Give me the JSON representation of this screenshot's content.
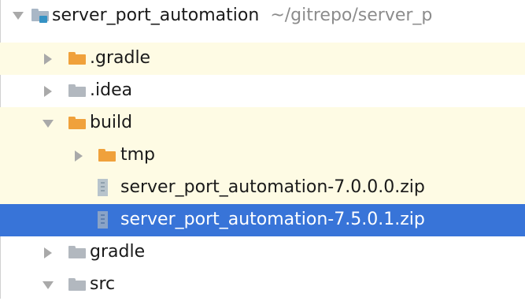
{
  "tree": {
    "root": {
      "name": "server_port_automation",
      "path": "~/gitrepo/server_p"
    },
    "items": [
      {
        "label": ".gradle"
      },
      {
        "label": ".idea"
      },
      {
        "label": "build"
      },
      {
        "label": "tmp"
      },
      {
        "label": "server_port_automation-7.0.0.0.zip"
      },
      {
        "label": "server_port_automation-7.5.0.1.zip"
      },
      {
        "label": "gradle"
      },
      {
        "label": "src"
      }
    ]
  },
  "colors": {
    "selection": "#3874d8",
    "excluded_folder_highlight": "#fefbe4",
    "orange_folder": "#f0a13b",
    "path_text": "#8c8c8c"
  },
  "icons": {
    "expanded": "triangle-down-icon",
    "collapsed": "triangle-right-icon",
    "module_folder": "module-folder-icon",
    "excluded_folder": "excluded-folder-icon",
    "plain_folder": "folder-icon",
    "archive": "zip-archive-icon"
  }
}
